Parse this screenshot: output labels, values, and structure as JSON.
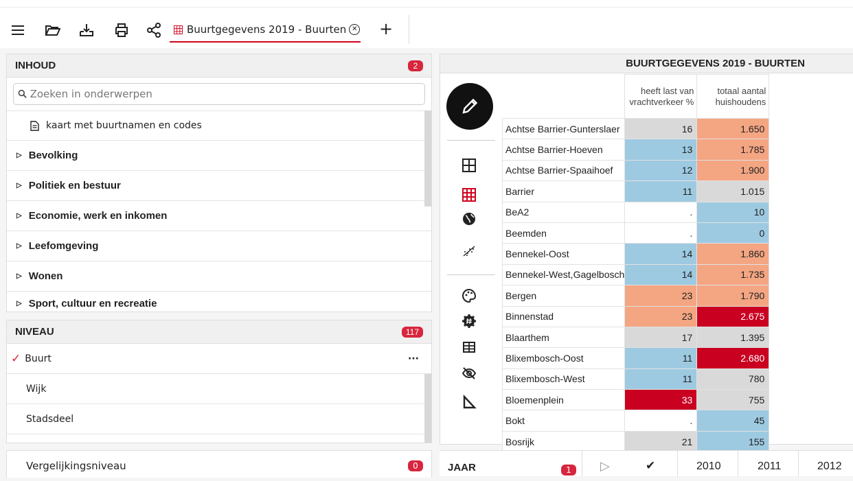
{
  "toolbar": {
    "icons": [
      "menu-icon",
      "folder-open-icon",
      "download-icon",
      "print-icon",
      "share-icon"
    ],
    "tab_title": "Buurtgegevens 2019 - Buurten",
    "tab_add": "+",
    "tab_close": "✕"
  },
  "inhoud": {
    "title": "INHOUD",
    "badge": "2",
    "search_placeholder": "Zoeken in onderwerpen",
    "items": [
      {
        "label": "kaart met buurtnamen en codes"
      },
      {
        "label": "Bevolking"
      },
      {
        "label": "Politiek en bestuur"
      },
      {
        "label": "Economie, werk en inkomen"
      },
      {
        "label": "Leefomgeving"
      },
      {
        "label": "Wonen"
      },
      {
        "label": "Sport, cultuur en recreatie"
      }
    ]
  },
  "niveau": {
    "title": "NIVEAU",
    "badge": "117",
    "items": [
      "Buurt",
      "Wijk",
      "Stadsdeel"
    ],
    "selected": "Buurt",
    "more": "···"
  },
  "vergelijking": {
    "label": "Vergelijkingsniveau",
    "badge": "0"
  },
  "table": {
    "title": "BUURTGEGEVENS 2019 - BUURTEN",
    "col1_line1": "heeft last van",
    "col1_line2": "vrachtverkeer %",
    "col2_line1": "totaal aantal",
    "col2_line2": "huishoudens",
    "rows": [
      {
        "name": "Achtse Barrier-Gunterslaer",
        "v1": "16",
        "c1": "gray",
        "v2": "1.650",
        "c2": "salmon"
      },
      {
        "name": "Achtse Barrier-Hoeven",
        "v1": "13",
        "c1": "blue",
        "v2": "1.785",
        "c2": "salmon"
      },
      {
        "name": "Achtse Barrier-Spaaihoef",
        "v1": "12",
        "c1": "blue",
        "v2": "1.900",
        "c2": "salmon"
      },
      {
        "name": "Barrier",
        "v1": "11",
        "c1": "blue",
        "v2": "1.015",
        "c2": "gray"
      },
      {
        "name": "BeA2",
        "v1": ".",
        "c1": "white",
        "v2": "10",
        "c2": "blue"
      },
      {
        "name": "Beemden",
        "v1": ".",
        "c1": "white",
        "v2": "0",
        "c2": "blue"
      },
      {
        "name": "Bennekel-Oost",
        "v1": "14",
        "c1": "blue",
        "v2": "1.860",
        "c2": "salmon"
      },
      {
        "name": "Bennekel-West,Gagelbosch",
        "v1": "14",
        "c1": "blue",
        "v2": "1.735",
        "c2": "salmon"
      },
      {
        "name": "Bergen",
        "v1": "23",
        "c1": "salmon",
        "v2": "1.790",
        "c2": "salmon"
      },
      {
        "name": "Binnenstad",
        "v1": "23",
        "c1": "salmon",
        "v2": "2.675",
        "c2": "red"
      },
      {
        "name": "Blaarthem",
        "v1": "17",
        "c1": "gray",
        "v2": "1.395",
        "c2": "gray"
      },
      {
        "name": "Blixembosch-Oost",
        "v1": "11",
        "c1": "blue",
        "v2": "2.680",
        "c2": "red"
      },
      {
        "name": "Blixembosch-West",
        "v1": "11",
        "c1": "blue",
        "v2": "780",
        "c2": "gray"
      },
      {
        "name": "Bloemenplein",
        "v1": "33",
        "c1": "red",
        "v2": "755",
        "c2": "gray"
      },
      {
        "name": "Bokt",
        "v1": ".",
        "c1": "white",
        "v2": "45",
        "c2": "blue"
      },
      {
        "name": "Bosrijk",
        "v1": "21",
        "c1": "gray",
        "v2": "155",
        "c2": "blue"
      }
    ]
  },
  "jaar": {
    "title": "JAAR",
    "badge": "1",
    "years": [
      "2010",
      "2011",
      "2012"
    ]
  },
  "colors": {
    "gray": "#d9d9d9",
    "blue": "#9ecae1",
    "salmon": "#f4a582",
    "red": "#ca0020",
    "accent": "#d7263d"
  }
}
